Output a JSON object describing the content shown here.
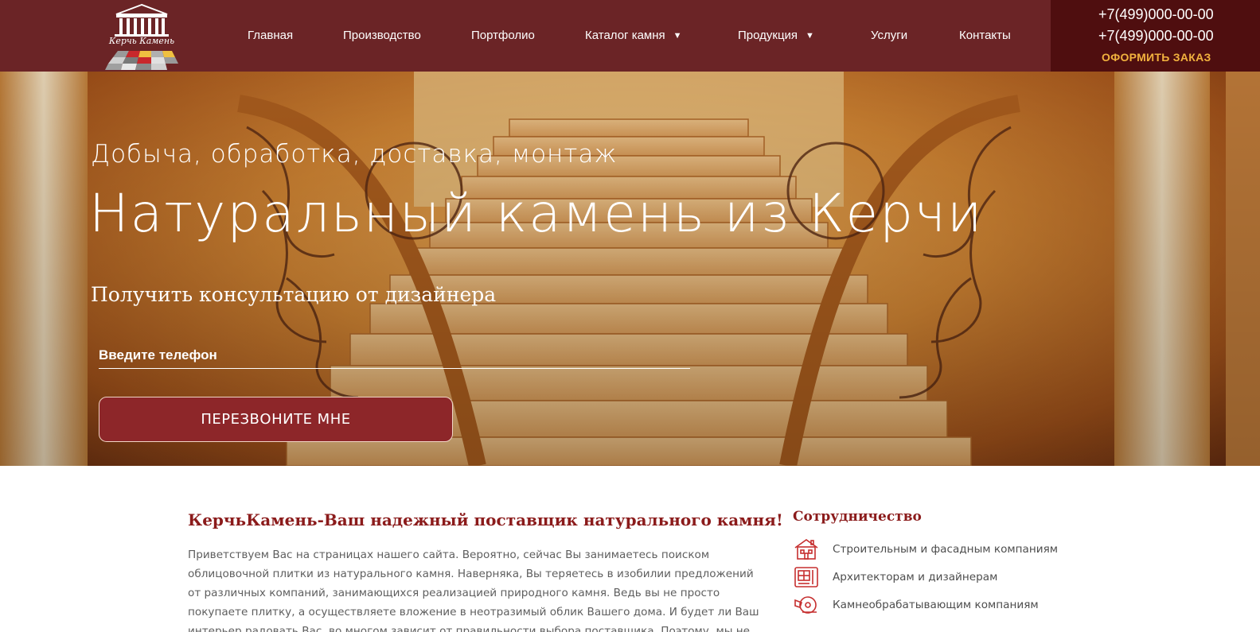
{
  "header": {
    "logo_text": "Керчь Камень",
    "nav": [
      {
        "label": "Главная"
      },
      {
        "label": "Производство"
      },
      {
        "label": "Портфолио"
      },
      {
        "label": "Каталог камня",
        "dropdown": true
      },
      {
        "label": "Продукция",
        "dropdown": true
      },
      {
        "label": "Услуги"
      },
      {
        "label": "Контакты"
      }
    ],
    "phones": [
      "+7(499)000-00-00",
      "+7(499)000-00-00"
    ],
    "order_label": "ОФОРМИТЬ ЗАКАЗ"
  },
  "hero": {
    "subtitle": "Добыча, обработка, доставка, монтаж",
    "title": "Натуральный камень из Керчи",
    "consult": "Получить консультацию от дизайнера",
    "phone_placeholder": "Введите телефон",
    "button_label": "ПЕРЕЗВОНИТЕ МНЕ"
  },
  "about": {
    "title": "КерчьКамень-Ваш надежный поставщик натурального камня!",
    "text": "Приветствуем Вас на страницах нашего сайта. Вероятно, сейчас Вы занимаетесь поиском облицовочной плитки из натурального камня. Наверняка, Вы теряетесь в изобилии предложений от различных компаний, занимающихся реализацией природного камня. Ведь вы не просто покупаете плитку, а осуществляете вложение в неотразимый облик Вашего дома. И будет ли Ваш интерьер радовать Вас, во многом зависит от правильности выбора поставщика. Поэтому, мы не будем загружать Вас лишней информацией, а"
  },
  "cooperation": {
    "title": "Сотрудничество",
    "items": [
      {
        "label": "Строительным и фасадным компаниям",
        "icon": "house-icon"
      },
      {
        "label": "Архитекторам и дизайнерам",
        "icon": "blueprint-icon"
      },
      {
        "label": "Камнеобрабатывающим компаниям",
        "icon": "stone-saw-icon"
      }
    ]
  },
  "colors": {
    "header_bg": "#6b2426",
    "contact_bg": "#4f0e0f",
    "accent_orange": "#f2b23e",
    "button_bg": "#8d2629",
    "title_red": "#8b1b1b"
  }
}
